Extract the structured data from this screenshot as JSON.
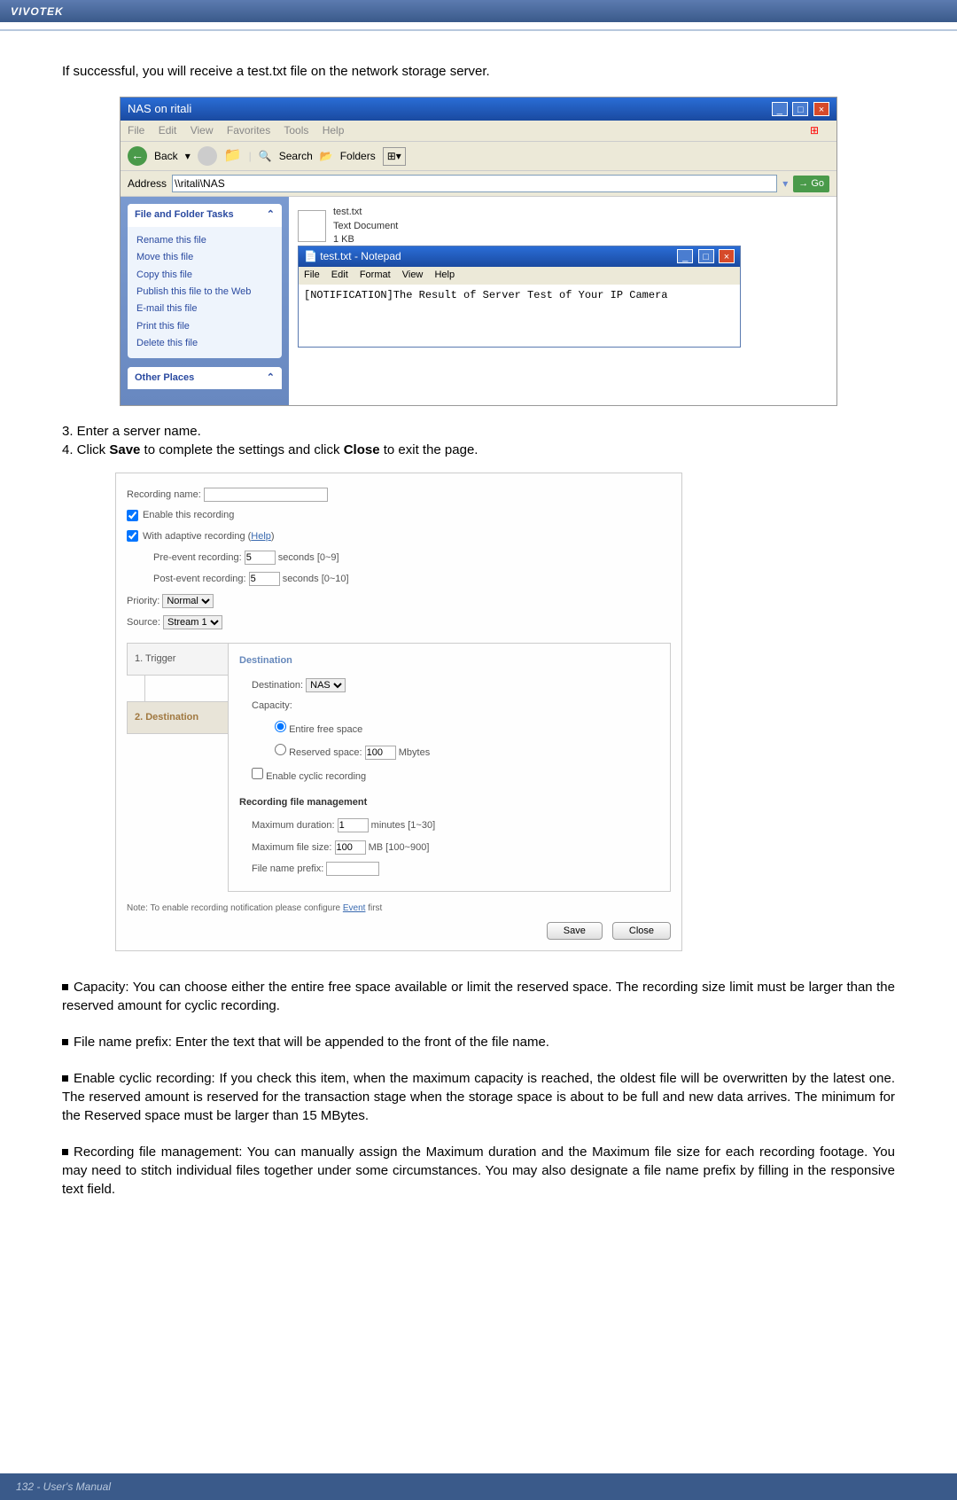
{
  "header": {
    "brand": "VIVOTEK"
  },
  "intro": "If successful, you will receive a test.txt file on the network storage server.",
  "explorer": {
    "title": "NAS on ritali",
    "menu": {
      "file": "File",
      "edit": "Edit",
      "view": "View",
      "fav": "Favorites",
      "tools": "Tools",
      "help": "Help"
    },
    "toolbar": {
      "back": "Back",
      "search": "Search",
      "folders": "Folders"
    },
    "address_label": "Address",
    "address_value": "\\\\ritali\\NAS",
    "go": "Go",
    "panel1_title": "File and Folder Tasks",
    "panel1_items": [
      "Rename this file",
      "Move this file",
      "Copy this file",
      "Publish this file to the Web",
      "E-mail this file",
      "Print this file",
      "Delete this file"
    ],
    "panel2_title": "Other Places",
    "file_name": "test.txt",
    "file_type": "Text Document",
    "file_size": "1 KB"
  },
  "notepad": {
    "title": "test.txt - Notepad",
    "menu": {
      "file": "File",
      "edit": "Edit",
      "format": "Format",
      "view": "View",
      "help": "Help"
    },
    "body": "[NOTIFICATION]The Result of Server Test of Your IP Camera"
  },
  "steps": {
    "s3": "3. Enter a server name.",
    "s4_a": "4. Click ",
    "s4_b": "Save",
    "s4_c": " to complete the settings and click ",
    "s4_d": "Close",
    "s4_e": " to exit the page."
  },
  "form": {
    "recname_lbl": "Recording name:",
    "enable": "Enable this recording",
    "adaptive": "With adaptive recording (",
    "help": "Help",
    "pre_lbl": "Pre-event recording:",
    "pre_val": "5",
    "pre_unit": "seconds [0~9]",
    "post_lbl": "Post-event recording:",
    "post_val": "5",
    "post_unit": "seconds [0~10]",
    "priority_lbl": "Priority:",
    "priority_val": "Normal",
    "source_lbl": "Source:",
    "source_val": "Stream 1",
    "tab1": "1. Trigger",
    "tab2": "2. Destination",
    "dest_legend": "Destination",
    "dest_lbl": "Destination:",
    "dest_val": "NAS",
    "cap_lbl": "Capacity:",
    "entire": "Entire free space",
    "reserved_lbl": "Reserved space:",
    "reserved_val": "100",
    "reserved_unit": "Mbytes",
    "cyclic": "Enable cyclic recording",
    "rfm": "Recording file management",
    "maxdur_lbl": "Maximum duration:",
    "maxdur_val": "1",
    "maxdur_unit": "minutes [1~30]",
    "maxsize_lbl": "Maximum file size:",
    "maxsize_val": "100",
    "maxsize_unit": "MB [100~900]",
    "prefix_lbl": "File name prefix:",
    "note_a": "Note: To enable recording notification please configure ",
    "note_link": "Event",
    "note_b": " first",
    "save": "Save",
    "close": "Close"
  },
  "bullets": {
    "b1": "Capacity: You can choose either the entire free space available or limit the reserved space. The recording size limit must be larger than the reserved amount for cyclic recording.",
    "b2": "File name prefix: Enter the text that will be appended to the front of the file name.",
    "b3": "Enable cyclic recording: If you check this item, when the maximum capacity is reached, the oldest file will be overwritten by the latest one. The reserved amount is reserved for the transaction stage when the storage space is about to be full and new data arrives. The minimum for the Reserved space must be larger than 15 MBytes.",
    "b4": "Recording file management: You can manually assign the Maximum duration and the Maximum file size for each recording footage. You may need to stitch individual files together under some circumstances. You may also designate a file name prefix by filling in the responsive text field."
  },
  "footer": "132 - User's Manual"
}
